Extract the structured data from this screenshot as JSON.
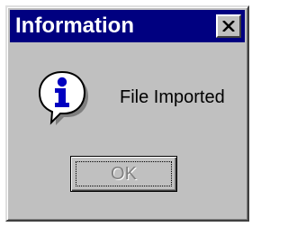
{
  "dialog": {
    "title": "Information",
    "close_icon": "close-icon",
    "message_icon": "information-icon",
    "message": "File Imported",
    "ok_label": "OK"
  },
  "colors": {
    "titlebar": "#000080",
    "face": "#c0c0c0",
    "icon_blue": "#0000c0"
  }
}
